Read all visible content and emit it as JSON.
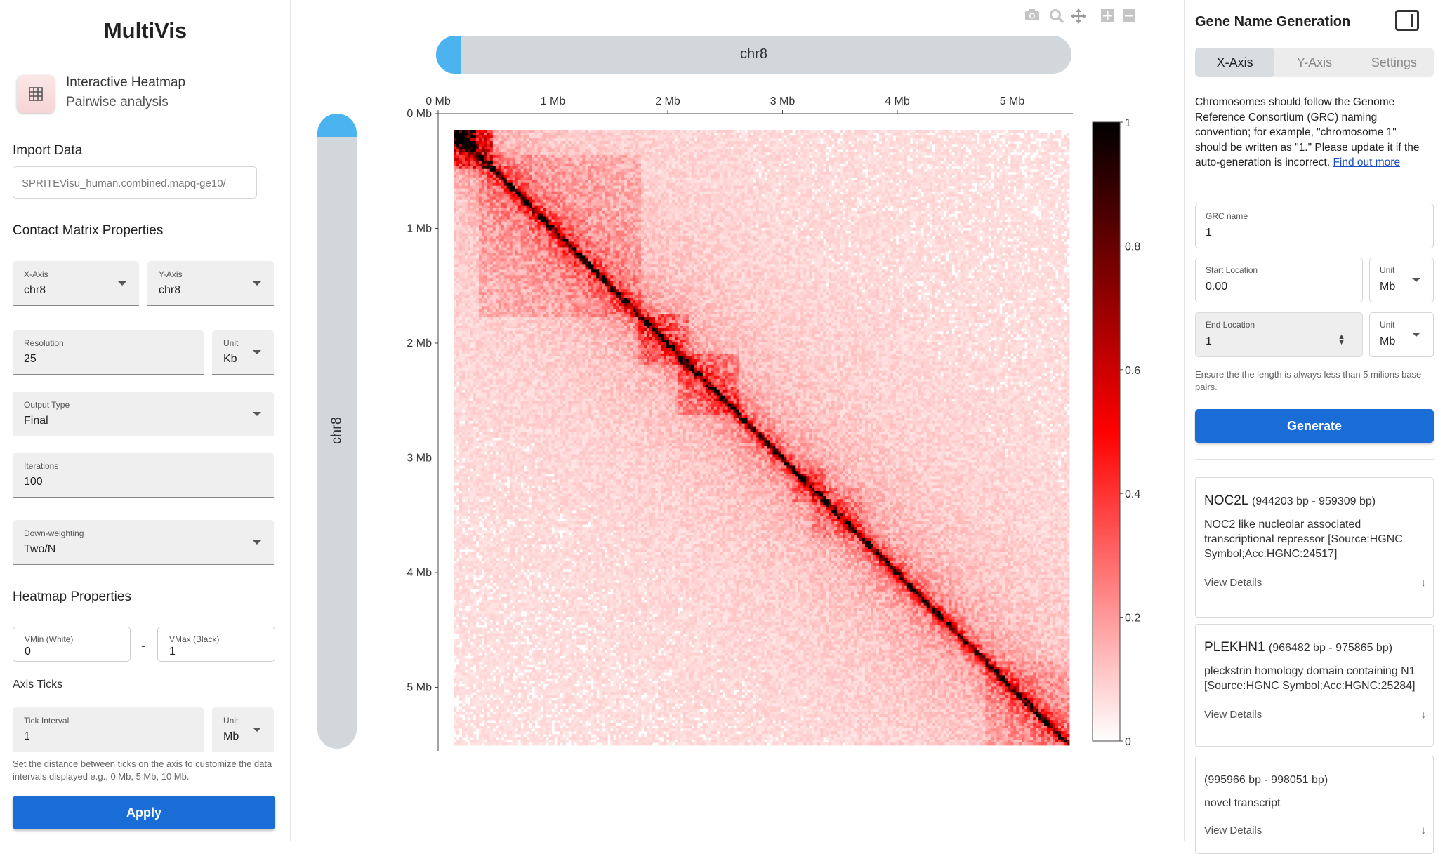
{
  "app": {
    "title": "MultiVis"
  },
  "mode": {
    "title": "Interactive Heatmap",
    "subtitle": "Pairwise analysis",
    "icon": "grid-icon"
  },
  "import": {
    "heading": "Import Data",
    "file": "SPRITEVisu_human.combined.mapq-ge10/"
  },
  "contact": {
    "heading": "Contact Matrix Properties",
    "x_axis": {
      "label": "X-Axis",
      "value": "chr8"
    },
    "y_axis": {
      "label": "Y-Axis",
      "value": "chr8"
    },
    "resolution": {
      "label": "Resolution",
      "value": "25"
    },
    "resolution_unit": {
      "label": "Unit",
      "value": "Kb"
    },
    "output_type": {
      "label": "Output Type",
      "value": "Final"
    },
    "iterations": {
      "label": "Iterations",
      "value": "100"
    },
    "downweighting": {
      "label": "Down-weighting",
      "value": "Two/N"
    }
  },
  "heatmap_props": {
    "heading": "Heatmap Properties",
    "vmin": {
      "label": "VMin (White)",
      "value": "0"
    },
    "separator": "-",
    "vmax": {
      "label": "VMax (Black)",
      "value": "1"
    },
    "axis_ticks_heading": "Axis Ticks",
    "tick_interval": {
      "label": "Tick Interval",
      "value": "1"
    },
    "tick_unit": {
      "label": "Unit",
      "value": "Mb"
    },
    "helper": "Set the distance between ticks on the axis to customize the data intervals displayed e.g., 0 Mb, 5 Mb, 10 Mb.",
    "apply_label": "Apply"
  },
  "viewer": {
    "toolbar": [
      "camera-icon",
      "zoom-icon",
      "pan-icon",
      "zoom-in-icon",
      "zoom-out-icon"
    ],
    "x_chrom": "chr8",
    "y_chrom": "chr8",
    "chrom_color": "#4bb3f0"
  },
  "chart_data": {
    "type": "heatmap",
    "title": "",
    "x_chrom": "chr8",
    "y_chrom": "chr8",
    "x_ticks": [
      "0 Mb",
      "1 Mb",
      "2 Mb",
      "3 Mb",
      "4 Mb",
      "5 Mb"
    ],
    "y_ticks": [
      "0 Mb",
      "1 Mb",
      "2 Mb",
      "3 Mb",
      "4 Mb",
      "5 Mb"
    ],
    "x_range_mb": [
      0,
      5.5
    ],
    "y_range_mb": [
      0,
      5.5
    ],
    "colorbar": {
      "min": 0,
      "max": 1,
      "ticks": [
        "0",
        "0.2",
        "0.4",
        "0.6",
        "0.8",
        "1"
      ],
      "colors": [
        "#ffffff",
        "#ff0000",
        "#000000"
      ]
    }
  },
  "right": {
    "title": "Gene Name Generation",
    "tabs": [
      "X-Axis",
      "Y-Axis",
      "Settings"
    ],
    "para_text": "Chromosomes should follow the Genome Reference Consortium (GRC) naming convention; for example, \"chromosome 1\" should be written as \"1.\" Please update it if the auto-generation is incorrect.",
    "para_link": "Find out more",
    "grc": {
      "label": "GRC name",
      "value": "1"
    },
    "start": {
      "label": "Start Location",
      "value": "0.00"
    },
    "start_unit": {
      "label": "Unit",
      "value": "Mb"
    },
    "end": {
      "label": "End Location",
      "value": "1"
    },
    "end_unit": {
      "label": "Unit",
      "value": "Mb"
    },
    "help": "Ensure the the length is always less than 5 milions base pairs.",
    "generate_label": "Generate",
    "genes": [
      {
        "name": "NOC2L",
        "range": "(944203 bp - 959309 bp)",
        "desc": "NOC2 like nucleolar associated transcriptional repressor [Source:HGNC Symbol;Acc:HGNC:24517]",
        "view": "View Details"
      },
      {
        "name": "PLEKHN1",
        "range": "(966482 bp - 975865 bp)",
        "desc": "pleckstrin homology domain containing N1 [Source:HGNC Symbol;Acc:HGNC:25284]",
        "view": "View Details"
      },
      {
        "name": "",
        "range": "(995966 bp - 998051 bp)",
        "desc": "novel transcript",
        "view": "View Details"
      }
    ]
  }
}
